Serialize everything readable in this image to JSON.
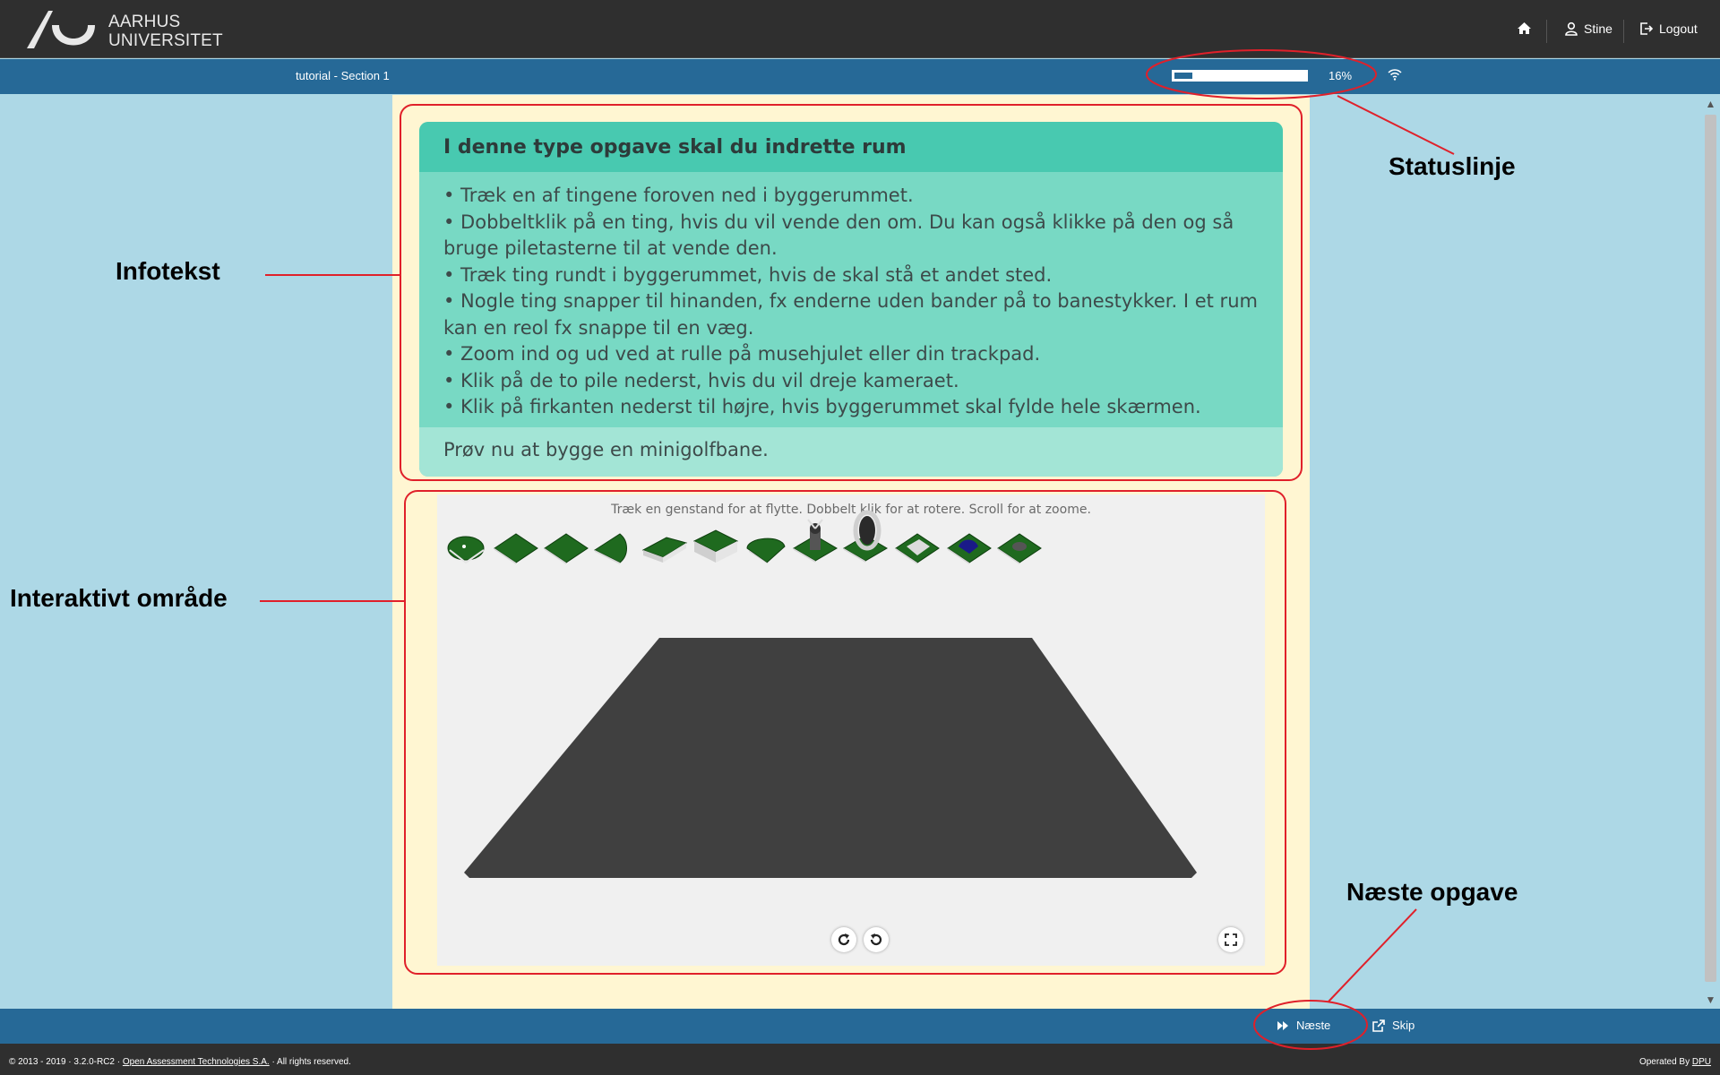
{
  "header": {
    "logo_text_line1": "AARHUS",
    "logo_text_line2": "UNIVERSITET",
    "home_icon": "home-icon",
    "user_icon": "user-icon",
    "user_label": "Stine",
    "logout_icon": "logout-icon",
    "logout_label": "Logout"
  },
  "status": {
    "section": "tutorial - Section 1",
    "progress_percent": 16,
    "progress_text": "16%",
    "connectivity_icon": "wifi-icon"
  },
  "info": {
    "title": "I denne type opgave skal du indrette rum",
    "items": [
      "• Træk en af tingene foroven ned i byggerummet.",
      "• Dobbeltklik på en ting, hvis du vil vende den om. Du kan også klikke på den og så bruge piletasterne til at vende den.",
      "• Træk ting rundt i byggerummet, hvis de skal stå et andet sted.",
      "• Nogle ting snapper til hinanden, fx enderne uden bander på to banestykker. I et rum kan en reol fx snappe til en væg.",
      "• Zoom ind og ud ved at rulle på musehjulet eller din trackpad.",
      "• Klik på de to pile nederst, hvis du vil dreje kameraet.",
      "• Klik på firkanten nederst til højre, hvis byggerummet skal fylde hele skærmen."
    ],
    "footer": "Prøv nu at bygge en minigolfbane."
  },
  "canvas": {
    "instruction": "Træk en genstand for at flytte. Dobbelt klik for at rotere. Scroll for at zoome.",
    "palette": [
      "minigolf-hole-piece",
      "minigolf-straight-piece",
      "minigolf-straight-piece",
      "minigolf-quarter-round-piece",
      "minigolf-ramp-piece",
      "minigolf-raised-block-piece",
      "minigolf-round-green-piece",
      "minigolf-windmill-piece",
      "minigolf-loop-piece",
      "minigolf-obstacle-piece",
      "minigolf-blue-hill-piece",
      "minigolf-bump-piece"
    ],
    "rotate_right_icon": "rotate-clockwise-icon",
    "rotate_left_icon": "rotate-counterclockwise-icon",
    "fullscreen_icon": "fullscreen-icon"
  },
  "nav": {
    "next_icon": "fast-forward-icon",
    "next_label": "Næste",
    "skip_icon": "external-link-icon",
    "skip_label": "Skip"
  },
  "footer": {
    "copyright_prefix": "© 2013 - 2019 · 3.2.0-RC2 ·",
    "copyright_link": "Open Assessment Technologies S.A.",
    "copyright_suffix": "· All rights reserved.",
    "operated_prefix": "Operated By",
    "operated_link": "DPU"
  },
  "annotations": {
    "statuslinje": "Statuslinje",
    "infotekst": "Infotekst",
    "interaktivt": "Interaktivt område",
    "naeste_opgave": "Næste opgave",
    "color": "#e0202a"
  },
  "colors": {
    "header_bg": "#2f2f2f",
    "bar_bg": "#266997",
    "page_bg": "#add8e6",
    "main_bg": "#fff6d2",
    "info_title_bg": "#48c9b0",
    "info_body_bg": "#78d9c4",
    "info_footer_bg": "#a3e5d6",
    "floor": "#404040"
  }
}
